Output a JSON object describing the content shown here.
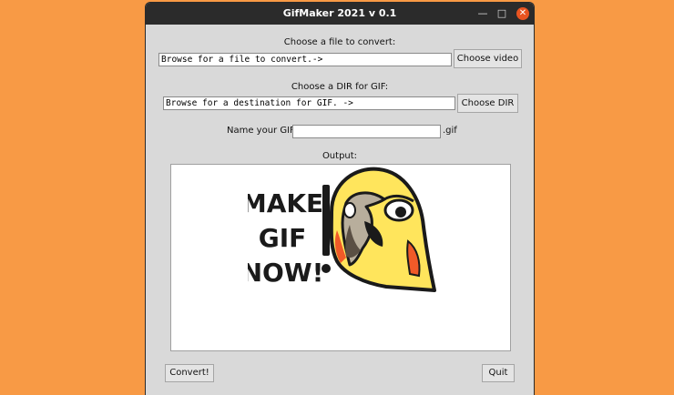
{
  "window": {
    "title": "GifMaker 2021 v 0.1",
    "minimize_glyph": "—",
    "maximize_glyph": "□",
    "close_glyph": "✕"
  },
  "file_section": {
    "label": "Choose a file to convert:",
    "entry_value": "Browse for a file to convert.->",
    "button_label": "Choose video"
  },
  "dir_section": {
    "label": "Choose a DIR for GIF:",
    "entry_value": "Browse for a destination for GIF. ->",
    "button_label": "Choose DIR"
  },
  "name_section": {
    "label": "Name your GIF:",
    "entry_value": "",
    "suffix": ".gif"
  },
  "output": {
    "label": "Output:",
    "logo_lines": [
      "MAKE",
      "GIF",
      "NOW!"
    ]
  },
  "footer": {
    "convert_label": "Convert!",
    "quit_label": "Quit"
  },
  "colors": {
    "desktop_background": "#F89A45",
    "window_background": "#D9D9D9",
    "titlebar": "#2B2B2B",
    "close_button": "#E95420",
    "parrot_yellow": "#FFE55C",
    "parrot_red": "#F05A28"
  }
}
